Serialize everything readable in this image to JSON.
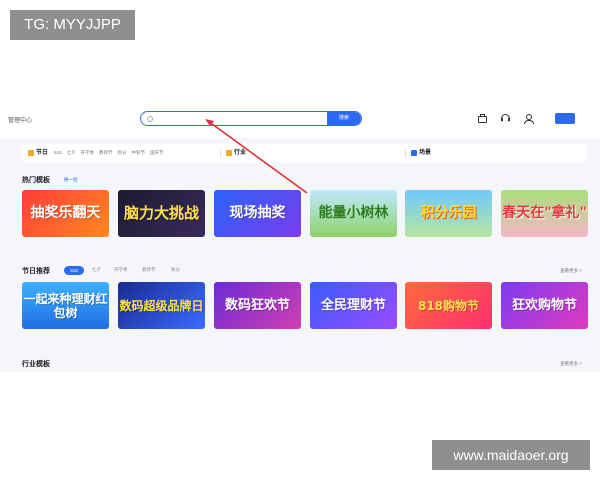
{
  "watermarks": {
    "top_left": "TG: MYYJJPP",
    "bottom_right": "www.maidaoer.org"
  },
  "header": {
    "brand": "管理中心",
    "search": {
      "placeholder": "",
      "button": "搜索"
    },
    "icons": [
      "briefcase-icon",
      "headset-icon",
      "user-icon"
    ],
    "pro_badge": ""
  },
  "categories": [
    {
      "title": "节日",
      "icon_color": "#f5a623",
      "tags": [
        "818",
        "七夕",
        "开学季",
        "教师节",
        "秋分",
        "中秋节",
        "国庆节"
      ]
    },
    {
      "title": "行业",
      "icon_color": "#f5a623",
      "tags": [
        "",
        "",
        "",
        "",
        ""
      ]
    },
    {
      "title": "场景",
      "icon_color": "#2c6bf0",
      "tags": [
        "",
        "",
        "",
        "",
        ""
      ]
    }
  ],
  "hot": {
    "title": "热门模板",
    "switch_label": "换一批",
    "cards": [
      {
        "title": "抽奖乐翻天",
        "caption": ""
      },
      {
        "title": "脑力大挑战",
        "caption": ""
      },
      {
        "title": "现场抽奖",
        "caption": ""
      },
      {
        "title": "能量小树林",
        "caption": ""
      },
      {
        "title": "积分乐园",
        "caption": ""
      },
      {
        "title": "春天在\"拿礼\"",
        "caption": ""
      }
    ]
  },
  "festival": {
    "title": "节日推荐",
    "filters": [
      "818",
      "七夕",
      "开学季",
      "教师节",
      "秋分"
    ],
    "more": "查看更多 >",
    "cards": [
      {
        "title": "一起来种理财红包树",
        "caption": ""
      },
      {
        "title": "数码超级品牌日",
        "caption": ""
      },
      {
        "title": "数码狂欢节",
        "caption": ""
      },
      {
        "title": "全民理财节",
        "caption": ""
      },
      {
        "title": "818购物节",
        "caption": ""
      },
      {
        "title": "狂欢购物节",
        "caption": ""
      }
    ]
  },
  "industry": {
    "title": "行业模板",
    "more": "查看更多 >"
  },
  "colors": {
    "accent": "#2c6bf0",
    "annotation_arrow": "#e03030"
  }
}
